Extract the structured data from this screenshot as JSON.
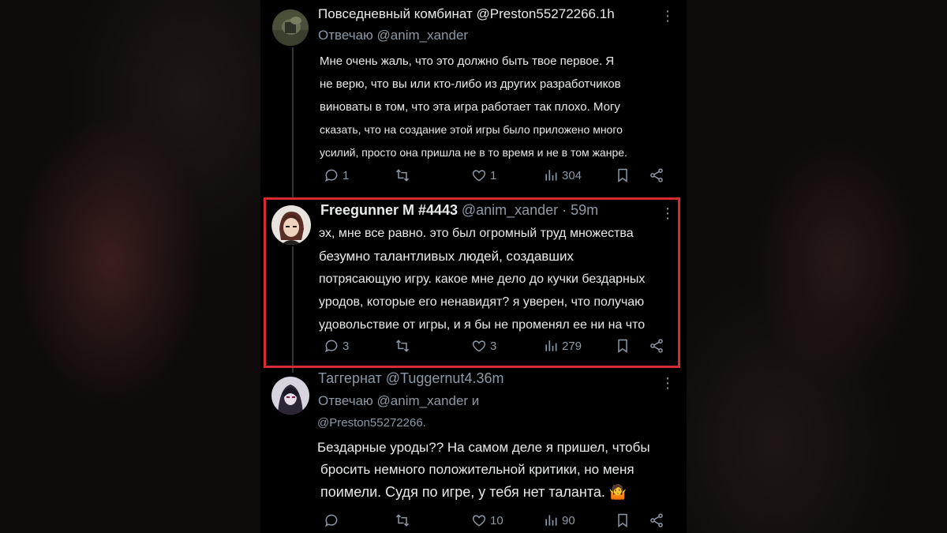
{
  "posts": [
    {
      "name": "Повседневный комбинат",
      "handle_time": "@Preston55272266.1h",
      "reply_prefix": "Отвечаю",
      "reply_to": "@anim_xander",
      "lines": [
        "Мне очень жаль, что это должно быть твое первое. Я",
        "не верю, что вы или кто-либо из других разработчиков",
        "виноваты в том, что эта игра работает так плохо. Могу",
        "сказать, что на создание этой игры было приложено много",
        "усилий, просто она пришла не в то время и не в том жанре."
      ],
      "replies": "1",
      "reposts": "",
      "likes": "1",
      "views": "304"
    },
    {
      "name": "Freegunner M #4443",
      "handle_time": "@anim_xander · 59m",
      "lines": [
        "эх, мне все равно. это был огромный труд множества",
        "безумно талантливых людей, создавших",
        "потрясающую игру. какое мне дело до кучки бездарных",
        "уродов, которые его ненавидят? я уверен, что получаю",
        "удовольствие от игры, и я бы не променял ее ни на что"
      ],
      "replies": "3",
      "reposts": "",
      "likes": "3",
      "views": "279"
    },
    {
      "name": "Таггернат",
      "handle_time": "@Tuggernut4.36m",
      "reply_prefix": "Отвечаю",
      "reply_to": "@anim_xander и",
      "reply_to_2": "@Preston55272266.",
      "lines": [
        "Бездарные уроды?? На самом деле я пришел, чтобы",
        "бросить немного положительной критики, но меня",
        "поимели. Судя по игре, у тебя нет таланта. 🤷"
      ],
      "replies": "",
      "reposts": "",
      "likes": "10",
      "views": "90"
    }
  ],
  "icons": {
    "reply": "comment-icon",
    "repost": "repost-icon",
    "like": "heart-icon",
    "views": "views-chart-icon",
    "bookmark": "bookmark-icon",
    "share": "share-icon",
    "more": "more-vertical-icon"
  },
  "colors": {
    "background": "#000000",
    "text": "#e7e9ea",
    "secondary": "#8b98a5",
    "highlight_border": "#d62b33"
  }
}
